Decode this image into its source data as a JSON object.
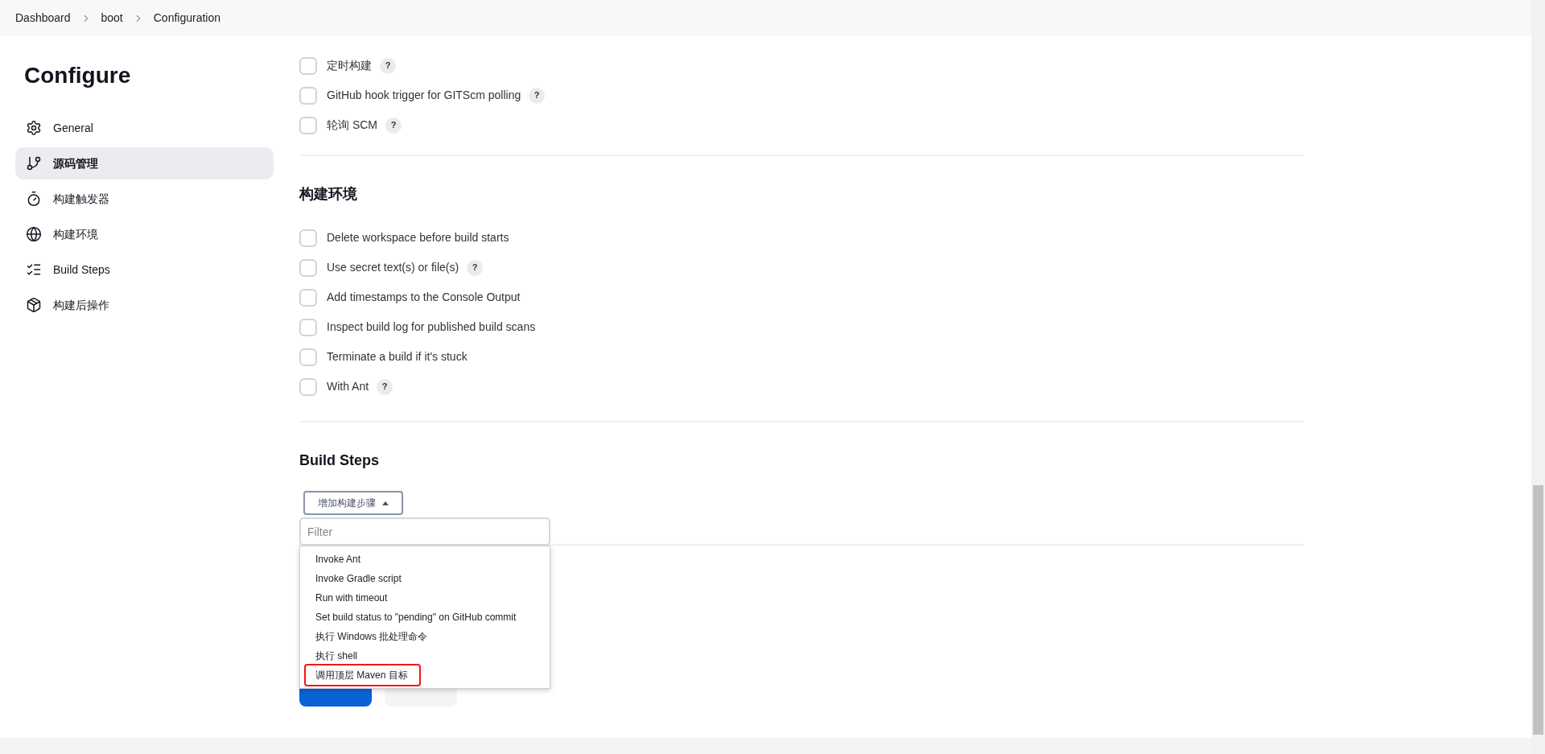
{
  "breadcrumbs": [
    "Dashboard",
    "boot",
    "Configuration"
  ],
  "sidebar": {
    "title": "Configure",
    "items": [
      {
        "label": "General",
        "selected": false
      },
      {
        "label": "源码管理",
        "selected": true
      },
      {
        "label": "构建触发器",
        "selected": false
      },
      {
        "label": "构建环境",
        "selected": false
      },
      {
        "label": "Build Steps",
        "selected": false
      },
      {
        "label": "构建后操作",
        "selected": false
      }
    ]
  },
  "triggers": [
    {
      "label": "定时构建",
      "checked": false,
      "help": "?"
    },
    {
      "label": "GitHub hook trigger for GITScm polling",
      "checked": false,
      "help": "?"
    },
    {
      "label": "轮询 SCM",
      "checked": false,
      "help": "?"
    }
  ],
  "environment": {
    "heading": "构建环境",
    "options": [
      {
        "label": "Delete workspace before build starts",
        "checked": false
      },
      {
        "label": "Use secret text(s) or file(s)",
        "checked": false,
        "help": "?"
      },
      {
        "label": "Add timestamps to the Console Output",
        "checked": false
      },
      {
        "label": "Inspect build log for published build scans",
        "checked": false
      },
      {
        "label": "Terminate a build if it's stuck",
        "checked": false
      },
      {
        "label": "With Ant",
        "checked": false,
        "help": "?"
      }
    ]
  },
  "build_steps": {
    "heading": "Build Steps",
    "add_button": "增加构建步骤",
    "expanded": true,
    "filter": {
      "placeholder": "Filter"
    },
    "menu": [
      {
        "label": "Invoke Ant",
        "highlighted": false
      },
      {
        "label": "Invoke Gradle script",
        "highlighted": false
      },
      {
        "label": "Run with timeout",
        "highlighted": false
      },
      {
        "label": "Set build status to \"pending\" on GitHub commit",
        "highlighted": false
      },
      {
        "label": "执行 Windows 批处理命令",
        "highlighted": false
      },
      {
        "label": "执行 shell",
        "highlighted": false
      },
      {
        "label": "调用顶层 Maven 目标",
        "highlighted": true
      }
    ]
  }
}
